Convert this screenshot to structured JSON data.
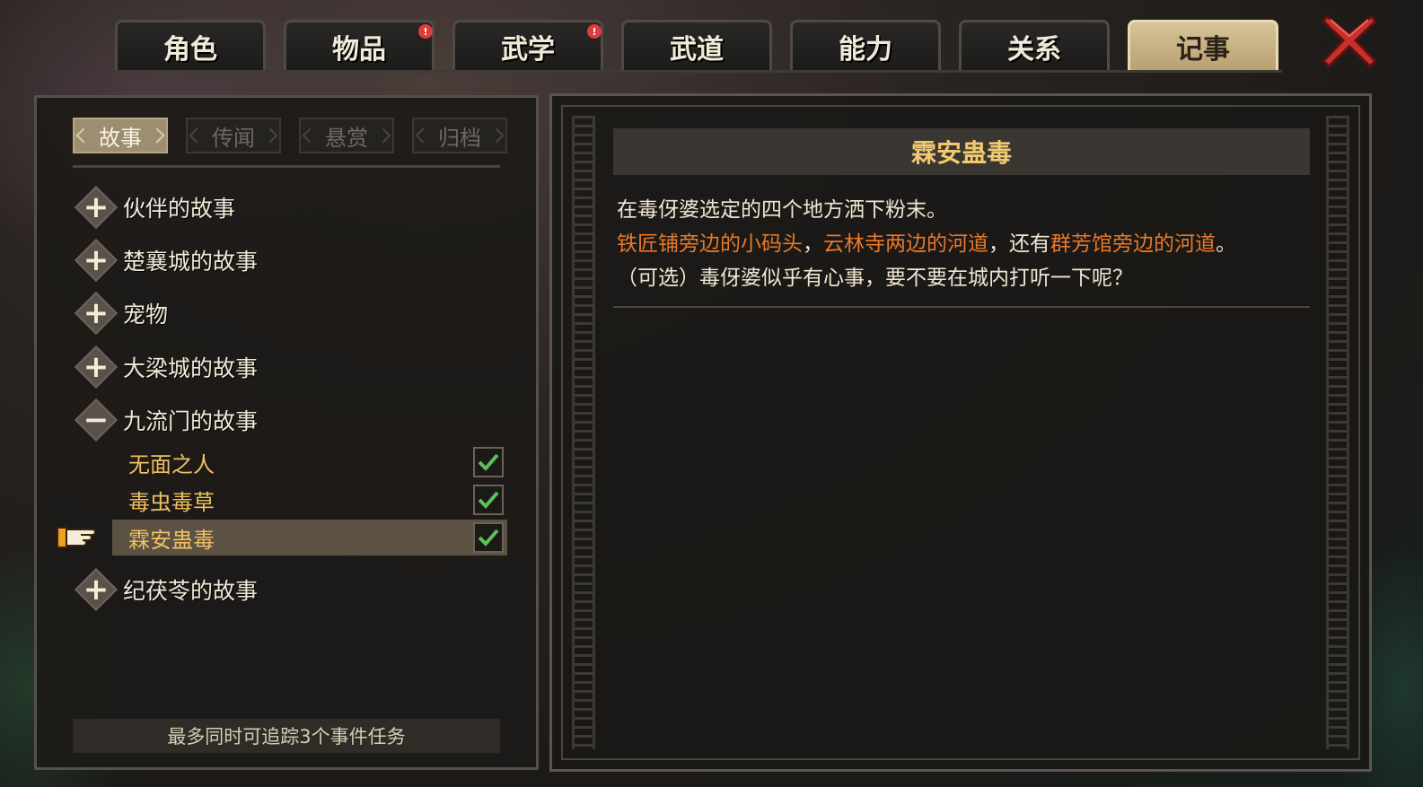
{
  "top_tabs": [
    {
      "label": "角色",
      "active": false,
      "notify": false
    },
    {
      "label": "物品",
      "active": false,
      "notify": true
    },
    {
      "label": "武学",
      "active": false,
      "notify": true
    },
    {
      "label": "武道",
      "active": false,
      "notify": false
    },
    {
      "label": "能力",
      "active": false,
      "notify": false
    },
    {
      "label": "关系",
      "active": false,
      "notify": false
    },
    {
      "label": "记事",
      "active": true,
      "notify": false
    }
  ],
  "notify_badge": "!",
  "sub_tabs": [
    {
      "label": "故事",
      "active": true
    },
    {
      "label": "传闻",
      "active": false
    },
    {
      "label": "悬赏",
      "active": false
    },
    {
      "label": "归档",
      "active": false
    }
  ],
  "categories": [
    {
      "label": "伙伴的故事",
      "expanded": false,
      "icon": "+"
    },
    {
      "label": "楚襄城的故事",
      "expanded": false,
      "icon": "+"
    },
    {
      "label": "宠物",
      "expanded": false,
      "icon": "+"
    },
    {
      "label": "大梁城的故事",
      "expanded": false,
      "icon": "+"
    },
    {
      "label": "九流门的故事",
      "expanded": true,
      "icon": "−"
    },
    {
      "label": "纪茯苓的故事",
      "expanded": false,
      "icon": "+"
    }
  ],
  "quests": [
    {
      "label": "无面之人",
      "tracked": true,
      "selected": false
    },
    {
      "label": "毒虫毒草",
      "tracked": true,
      "selected": false
    },
    {
      "label": "霖安蛊毒",
      "tracked": true,
      "selected": true
    }
  ],
  "footer_tip": "最多同时可追踪3个事件任务",
  "detail": {
    "title": "霖安蛊毒",
    "line1": "在毒伢婆选定的四个地方洒下粉末。",
    "line2_part1": "铁匠铺旁边的小码头",
    "line2_sep1": "，",
    "line2_part2": "云林寺两边的河道",
    "line2_sep2": "，还有",
    "line2_part3": "群芳馆旁边的河道",
    "line2_end": "。",
    "line3": "（可选）毒伢婆似乎有心事，要不要在城内打听一下呢？"
  },
  "colors": {
    "highlight": "#e8782a",
    "quest_text": "#f0c060",
    "title_text": "#f2c870",
    "check": "#5fbf5a",
    "close": "#c8302c"
  },
  "icons": {
    "close": "close-icon",
    "pointer": "pointing-hand-icon",
    "expand": "plus-icon",
    "collapse": "minus-icon",
    "check": "checkmark-icon"
  }
}
